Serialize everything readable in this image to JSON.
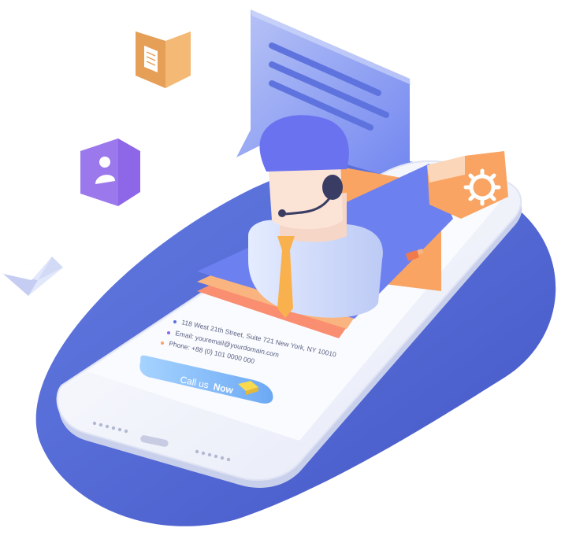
{
  "contact": {
    "address": "118 West 21th Street, Suite 721 New York, NY 10010",
    "email": "Email: youremail@yourdomain.com",
    "phone": "Phone: +88 (0) 101 0000 000"
  },
  "cta": {
    "label_prefix": "Call us",
    "label_strong": "Now"
  },
  "icons": [
    "document-icon",
    "user-icon",
    "envelope-icon",
    "gear-icon",
    "headset-icon",
    "tag-icon"
  ],
  "colors": {
    "blob": "#4a5fcf",
    "phone_body": "#f1f3fb",
    "screen": "#fafbff",
    "bubble": "#7f93f5",
    "accent_orange": "#f9a463",
    "accent_purple": "#8e67e8",
    "button": "#7cb8f7"
  }
}
